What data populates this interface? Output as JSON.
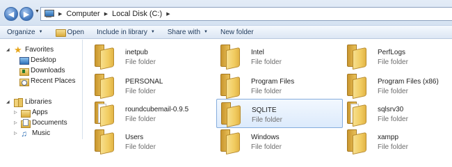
{
  "address_bar": {
    "breadcrumbs": [
      "Computer",
      "Local Disk (C:)"
    ]
  },
  "command_bar": {
    "organize": "Organize",
    "open": "Open",
    "include_in_library": "Include in library",
    "share_with": "Share with",
    "new_folder": "New folder"
  },
  "nav_pane": {
    "favorites": "Favorites",
    "desktop": "Desktop",
    "downloads": "Downloads",
    "recent_places": "Recent Places",
    "libraries": "Libraries",
    "apps": "Apps",
    "documents": "Documents",
    "music": "Music"
  },
  "folder_type_label": "File folder",
  "folders": [
    {
      "name": "inetpub"
    },
    {
      "name": "Intel"
    },
    {
      "name": "PerfLogs"
    },
    {
      "name": "PERSONAL"
    },
    {
      "name": "Program Files"
    },
    {
      "name": "Program Files (x86)"
    },
    {
      "name": "roundcubemail-0.9.5"
    },
    {
      "name": "SQLITE",
      "selected": true
    },
    {
      "name": "sqlsrv30"
    },
    {
      "name": "Users"
    },
    {
      "name": "Windows"
    },
    {
      "name": "xampp"
    }
  ]
}
